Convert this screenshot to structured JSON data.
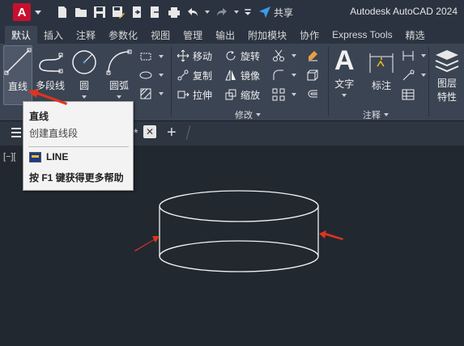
{
  "titlebar": {
    "logo_letter": "A",
    "share_label": "共享",
    "window_title": "Autodesk AutoCAD 2024"
  },
  "ribbon_tabs": [
    "默认",
    "插入",
    "注释",
    "参数化",
    "视图",
    "管理",
    "输出",
    "附加模块",
    "协作",
    "Express Tools",
    "精选"
  ],
  "ribbon": {
    "draw": {
      "line": "直线",
      "polyline": "多段线",
      "circle": "圆",
      "arc": "圆弧"
    },
    "modify": {
      "move": "移动",
      "rotate": "旋转",
      "copy": "复制",
      "mirror": "镜像",
      "stretch": "拉伸",
      "scale": "缩放",
      "panel_title": "修改"
    },
    "annotation": {
      "text": "文字",
      "dimension": "标注",
      "panel_title": "注释"
    },
    "layers": {
      "label_line1": "图层",
      "label_line2": "特性"
    }
  },
  "tooltip": {
    "title": "直线",
    "description": "创建直线段",
    "command": "LINE",
    "help": "按 F1 键获得更多帮助"
  },
  "filetabs": {
    "modified_mark": "*",
    "add": "+"
  },
  "canvas": {
    "viewport_label": "[−]["
  },
  "colors": {
    "arrow": "#e0341f",
    "accent_logo": "#c8102e"
  }
}
